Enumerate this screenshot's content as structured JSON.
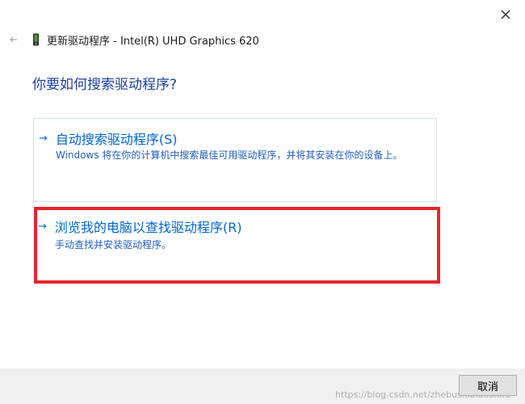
{
  "window": {
    "close_icon": "close-icon"
  },
  "titlebar": {
    "back_icon": "back-arrow-icon",
    "device_icon": "graphics-device-icon",
    "title": "更新驱动程序 - Intel(R) UHD Graphics 620"
  },
  "main": {
    "heading": "你要如何搜索驱动程序?",
    "options": [
      {
        "arrow": "→",
        "title": "自动搜索驱动程序(S)",
        "description": "Windows 将在你的计算机中搜索最佳可用驱动程序，并将其安装在你的设备上。"
      },
      {
        "arrow": "→",
        "title": "浏览我的电脑以查找驱动程序(R)",
        "description": "手动查找并安装驱动程序。"
      }
    ]
  },
  "footer": {
    "cancel_label": "取消",
    "watermark": "https://blog.csdn.net/zhebushibiaoshifu"
  },
  "colors": {
    "heading": "#1c3f99",
    "link": "#0066cc",
    "highlight": "#e8242d",
    "footer_bg": "#f0f0f0"
  }
}
